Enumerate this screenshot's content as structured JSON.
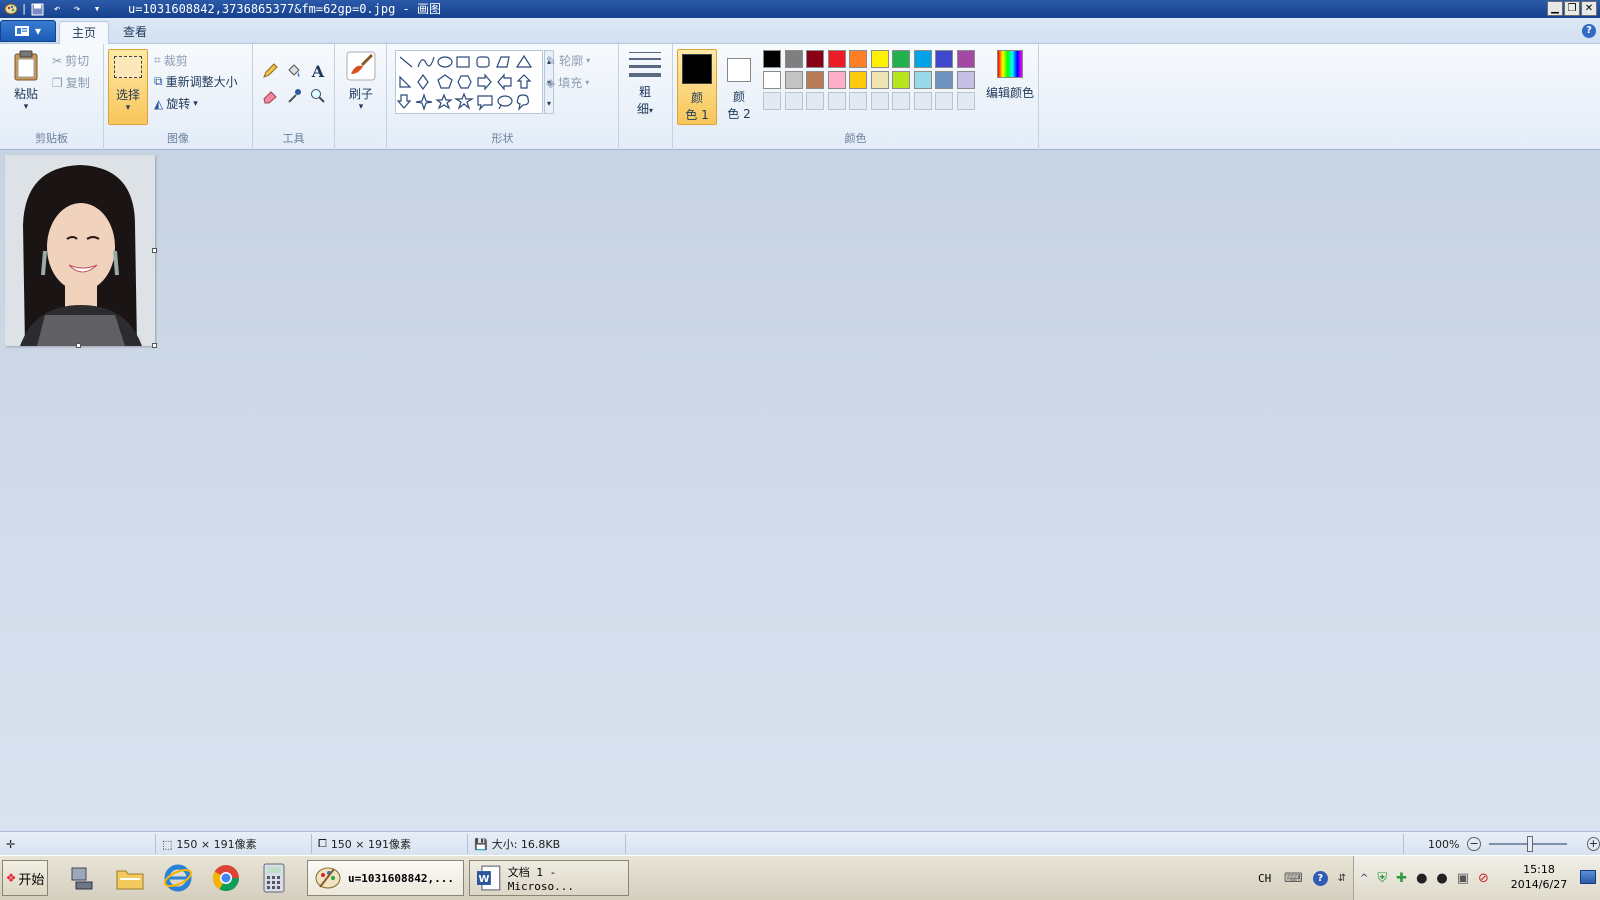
{
  "window": {
    "title": "u=1031608842,3736865377&fm=62gp=0.jpg - 画图",
    "controls": {
      "minimize": "▁",
      "restore": "❐",
      "close": "✕"
    }
  },
  "tabs": {
    "home": "主页",
    "view": "查看"
  },
  "ribbon": {
    "clipboard": {
      "label": "剪贴板",
      "paste": "粘贴",
      "cut": "剪切",
      "copy": "复制"
    },
    "image": {
      "label": "图像",
      "select": "选择",
      "crop": "裁剪",
      "resize": "重新调整大小",
      "rotate": "旋转"
    },
    "tools": {
      "label": "工具"
    },
    "brushes": {
      "label": "刷子"
    },
    "shapes": {
      "label": "形状",
      "outline": "轮廓",
      "fill": "填充"
    },
    "size": {
      "top": "粗",
      "bottom": "细"
    },
    "colors": {
      "label": "颜色",
      "color1_a": "颜",
      "color1_b": "色 1",
      "color2_a": "颜",
      "color2_b": "色 2",
      "edit": "编辑颜色",
      "color1": "#000000",
      "color2": "#ffffff",
      "palette_row1": [
        "#000000",
        "#7f7f7f",
        "#880015",
        "#ed1c24",
        "#ff7f27",
        "#fff200",
        "#22b14c",
        "#00a2e8",
        "#3f48cc",
        "#a349a4"
      ],
      "palette_row2": [
        "#ffffff",
        "#c3c3c3",
        "#b97a57",
        "#ffaec9",
        "#ffc90e",
        "#efe4b0",
        "#b5e61d",
        "#99d9ea",
        "#7092be",
        "#c8bfe7"
      ],
      "palette_row3": [
        "#e3e9f1",
        "#e3e9f1",
        "#e3e9f1",
        "#e3e9f1",
        "#e3e9f1",
        "#e3e9f1",
        "#e3e9f1",
        "#e3e9f1",
        "#e3e9f1",
        "#e3e9f1"
      ]
    }
  },
  "status": {
    "selection_size": "150 × 191像素",
    "image_size": "150 × 191像素",
    "file_size": "大小: 16.8KB",
    "zoom": "100%"
  },
  "taskbar": {
    "start": "开始",
    "task_paint": "u=1031608842,...",
    "task_word": "文档 1 - Microso...",
    "lang": "CH",
    "time": "15:18",
    "date": "2014/6/27"
  }
}
